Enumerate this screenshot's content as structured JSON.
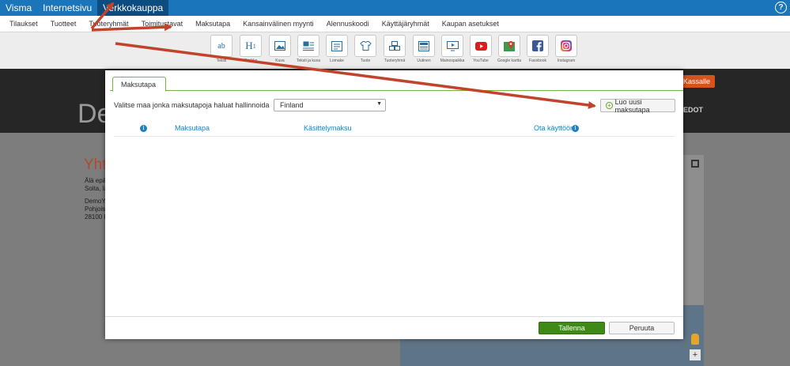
{
  "topbar": {
    "tabs": [
      "Visma",
      "Internetsivu",
      "Verkkokauppa"
    ],
    "active_tab": "Verkkokauppa",
    "help_icon": "question-circle-icon"
  },
  "subnav": {
    "items": [
      "Tilaukset",
      "Tuotteet",
      "Tuoteryhmät",
      "Toimitustavat",
      "Maksutapa",
      "Kansainvälinen myynti",
      "Alennuskoodi",
      "Käyttäjäryhmät",
      "Kaupan asetukset"
    ]
  },
  "toolbar": {
    "tools": [
      {
        "label": "Teksti",
        "icon": "ab"
      },
      {
        "label": "Otsikko",
        "icon": "H"
      },
      {
        "label": "Kuva",
        "icon": "image-icon"
      },
      {
        "label": "Teksti ja kuva",
        "icon": "text-image-icon"
      },
      {
        "label": "Lomake",
        "icon": "form-icon"
      },
      {
        "label": "Tuote",
        "icon": "tshirt-icon"
      },
      {
        "label": "Tuoteryhmä",
        "icon": "product-group-icon"
      },
      {
        "label": "Uutinen",
        "icon": "news-icon"
      },
      {
        "label": "Mainospaikka",
        "icon": "ad-slot-icon"
      },
      {
        "label": "YouTube",
        "icon": "youtube-icon"
      },
      {
        "label": "Google kartta",
        "icon": "map-pin-icon"
      },
      {
        "label": "Facebook",
        "icon": "facebook-icon"
      },
      {
        "label": "Instagram",
        "icon": "instagram-icon"
      }
    ]
  },
  "site": {
    "logo_fragment": "De",
    "cart_label": "Kassalle",
    "menu_fragment": "EDOT",
    "contact_title_fragment": "Yht",
    "lines": [
      "Älä epä",
      "Soita, lä",
      "DemoY",
      "Pohjois",
      "28100 P"
    ]
  },
  "modal": {
    "tab_label": "Maksutapa",
    "country_label": "Valitse maa jonka maksutapoja haluat hallinnoida",
    "country_value": "Finland",
    "add_button": "Luo uusi maksutapa",
    "columns": {
      "method": "Maksutapa",
      "fee": "Käsittelymaksu",
      "enable": "Ota käyttöön"
    },
    "save_label": "Tallenna",
    "cancel_label": "Peruuta"
  },
  "colors": {
    "topbar": "#1a75bb",
    "active_tab": "#0c4c80",
    "accent_green": "#3f8a16",
    "link_blue": "#1f7fc1",
    "arrow_red": "#c0432b",
    "cart_orange": "#d4541d"
  }
}
